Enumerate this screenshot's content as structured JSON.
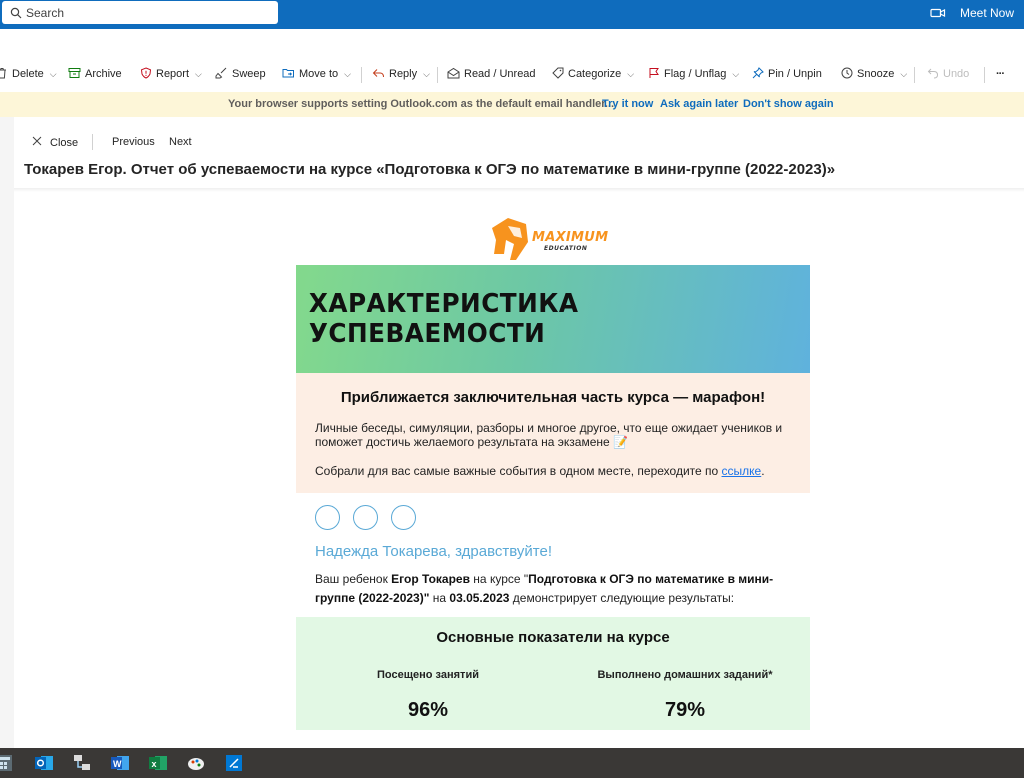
{
  "search": {
    "placeholder": "Search"
  },
  "header": {
    "meet_now": "Meet Now"
  },
  "toolbar": {
    "delete": "Delete",
    "archive": "Archive",
    "report": "Report",
    "sweep": "Sweep",
    "move_to": "Move to",
    "reply": "Reply",
    "read_unread": "Read / Unread",
    "categorize": "Categorize",
    "flag_unflag": "Flag / Unflag",
    "pin_unpin": "Pin / Unpin",
    "snooze": "Snooze",
    "undo": "Undo",
    "more": "···"
  },
  "notice": {
    "message": "Your browser supports setting Outlook.com as the default email handler...",
    "try_it": "Try it now",
    "ask_later": "Ask again later",
    "dont_show": "Don't show again"
  },
  "reading": {
    "close": "Close",
    "previous": "Previous",
    "next": "Next",
    "subject": "Токарев Егор. Отчет об успеваемости на курсе «Подготовка к ОГЭ по математике в мини-группе (2022-2023)»"
  },
  "email": {
    "logo_brand": "MAXIMUM",
    "logo_sub": "EDUCATION",
    "banner_title": "ХАРАКТЕРИСТИКА УСПЕВАЕМОСТИ",
    "marathon_title": "Приближается заключительная часть курса — марафон!",
    "marathon_p1": "Личные беседы, симуляции, разборы и многое другое, что еще ожидает учеников и поможет достичь желаемого результата на экзамене 📝",
    "marathon_p2_prefix": "Собрали для вас самые важные события в одном месте, переходите по ",
    "marathon_link": "ссылке",
    "marathon_p2_suffix": ".",
    "greeting": "Надежда Токарева, здравствуйте!",
    "child_intro": "Ваш ребенок ",
    "child_name": "Егор Токарев",
    "course_intro": " на курсе \"",
    "course_name": "Подготовка к ОГЭ по математике в мини-группе (2022-2023)\"",
    "date_intro": " на ",
    "date": "03.05.2023",
    "results_intro": " демонстрирует следующие результаты:",
    "stats_title": "Основные показатели на курсе",
    "attended_label": "Посещено занятий",
    "attended_value": "96%",
    "homework_label": "Выполнено домашних заданий*",
    "homework_value": "79%"
  },
  "taskbar": {
    "apps": [
      "calculator-icon",
      "outlook-icon",
      "network-icon",
      "word-icon",
      "excel-icon",
      "paint-icon",
      "snipping-icon"
    ]
  },
  "colors": {
    "brand_blue": "#0f6cbd",
    "notice_bg": "#fdf6d8",
    "logo_orange": "#f7931e",
    "marathon_bg": "#fdeee4",
    "stats_bg": "#e2f8e4",
    "accent_blue": "#5aa9d6"
  }
}
